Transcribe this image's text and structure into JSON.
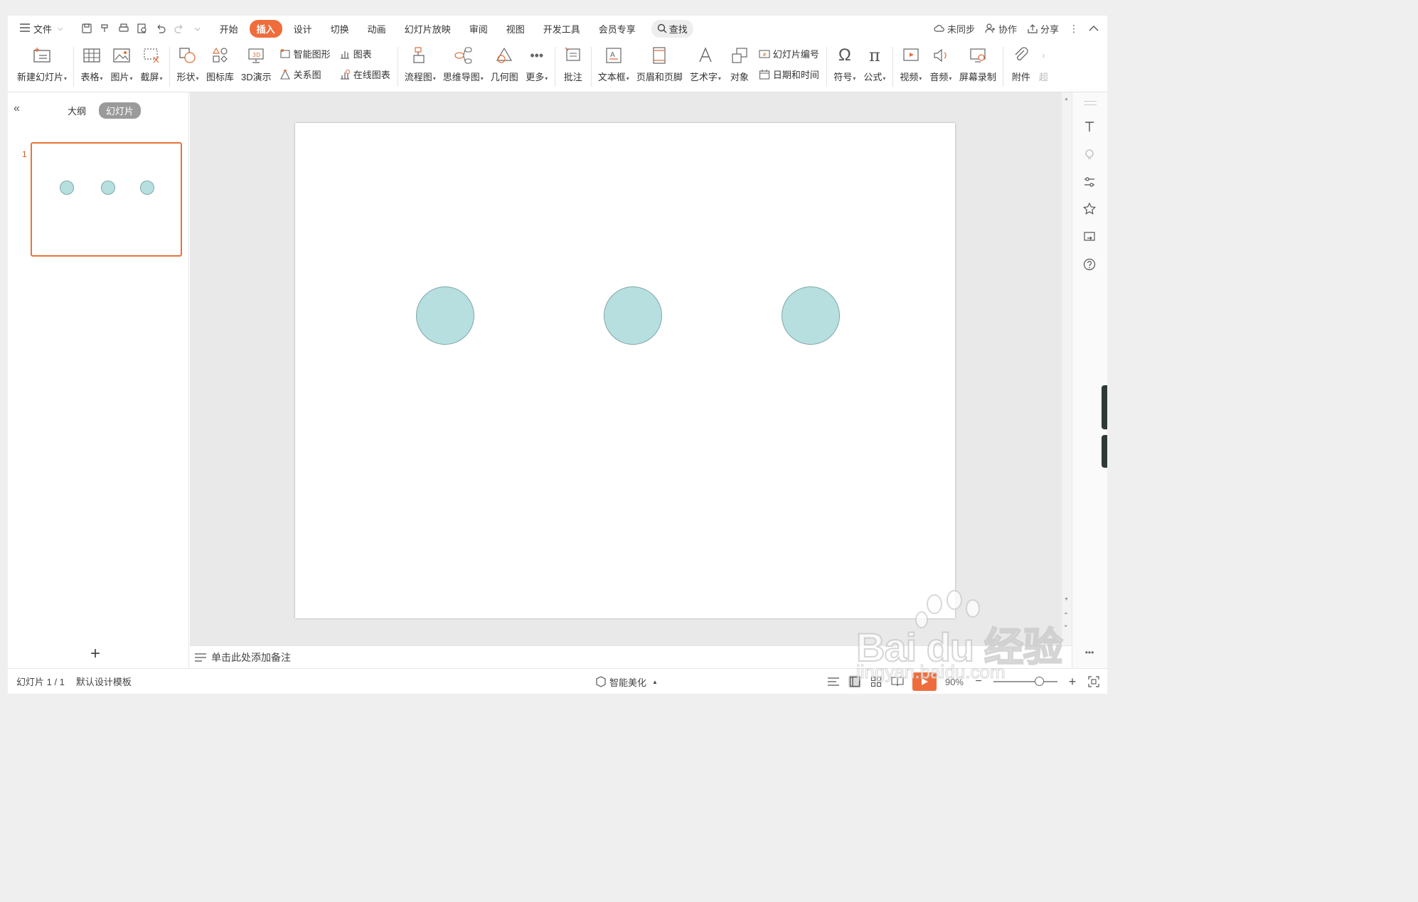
{
  "menu": {
    "file_label": "文件",
    "tabs": [
      {
        "label": "开始",
        "active": false
      },
      {
        "label": "插入",
        "active": true
      },
      {
        "label": "设计",
        "active": false
      },
      {
        "label": "切换",
        "active": false
      },
      {
        "label": "动画",
        "active": false
      },
      {
        "label": "幻灯片放映",
        "active": false
      },
      {
        "label": "审阅",
        "active": false
      },
      {
        "label": "视图",
        "active": false
      },
      {
        "label": "开发工具",
        "active": false
      },
      {
        "label": "会员专享",
        "active": false
      }
    ],
    "search_label": "查找",
    "right": {
      "sync": "未同步",
      "collab": "协作",
      "share": "分享"
    }
  },
  "ribbon": {
    "new_slide": "新建幻灯片",
    "table": "表格",
    "picture": "图片",
    "screenshot": "截屏",
    "shape": "形状",
    "icon_lib": "图标库",
    "demo3d": "3D演示",
    "smart_art": "智能图形",
    "relation": "关系图",
    "chart": "图表",
    "online_chart": "在线图表",
    "flowchart": "流程图",
    "mindmap": "思维导图",
    "geometry": "几何图",
    "more": "更多",
    "comment": "批注",
    "textbox": "文本框",
    "header_footer": "页眉和页脚",
    "wordart": "艺术字",
    "object": "对象",
    "slide_number": "幻灯片编号",
    "datetime": "日期和时间",
    "symbol": "符号",
    "formula": "公式",
    "video": "视频",
    "audio": "音频",
    "screen_record": "屏幕录制",
    "attachment": "附件",
    "overflow": "超"
  },
  "left_panel": {
    "outline_tab": "大纲",
    "slides_tab": "幻灯片",
    "slide_number": "1",
    "add_icon": "plus-icon"
  },
  "notes_placeholder": "单击此处添加备注",
  "status": {
    "slide_info": "幻灯片 1 / 1",
    "template": "默认设计模板",
    "beautify": "智能美化",
    "zoom": "90%"
  },
  "watermark": {
    "main": "Bai du 经验",
    "sub": "jingyan.baidu.com"
  },
  "colors": {
    "accent": "#ef6d3c",
    "circle_fill": "#b7dfe0",
    "circle_stroke": "#7fa6a8",
    "thumb_border": "#e8743a"
  }
}
